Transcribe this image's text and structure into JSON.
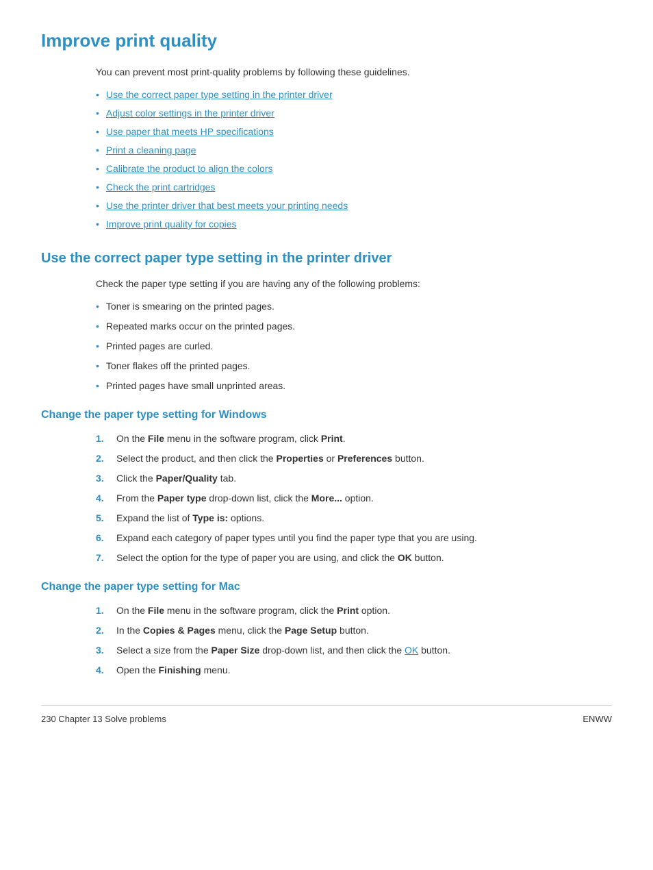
{
  "page": {
    "title": "Improve print quality",
    "intro": "You can prevent most print-quality problems by following these guidelines.",
    "toc": [
      "Use the correct paper type setting in the printer driver",
      "Adjust color settings in the printer driver",
      "Use paper that meets HP specifications",
      "Print a cleaning page",
      "Calibrate the product to align the colors",
      "Check the print cartridges",
      "Use the printer driver that best meets your printing needs",
      "Improve print quality for copies"
    ],
    "section1": {
      "title": "Use the correct paper type setting in the printer driver",
      "intro": "Check the paper type setting if you are having any of the following problems:",
      "problems": [
        "Toner is smearing on the printed pages.",
        "Repeated marks occur on the printed pages.",
        "Printed pages are curled.",
        "Toner flakes off the printed pages.",
        "Printed pages have small unprinted areas."
      ],
      "subsection_windows": {
        "title": "Change the paper type setting for Windows",
        "steps": [
          {
            "num": "1.",
            "text_parts": [
              {
                "t": "On the "
              },
              {
                "b": "File"
              },
              {
                "t": " menu in the software program, click "
              },
              {
                "b": "Print"
              },
              {
                "t": "."
              }
            ]
          },
          {
            "num": "2.",
            "text_parts": [
              {
                "t": "Select the product, and then click the "
              },
              {
                "b": "Properties"
              },
              {
                "t": " or "
              },
              {
                "b": "Preferences"
              },
              {
                "t": " button."
              }
            ]
          },
          {
            "num": "3.",
            "text_parts": [
              {
                "t": "Click the "
              },
              {
                "b": "Paper/Quality"
              },
              {
                "t": " tab."
              }
            ]
          },
          {
            "num": "4.",
            "text_parts": [
              {
                "t": "From the "
              },
              {
                "b": "Paper type"
              },
              {
                "t": " drop-down list, click the "
              },
              {
                "b": "More..."
              },
              {
                "t": " option."
              }
            ]
          },
          {
            "num": "5.",
            "text_parts": [
              {
                "t": "Expand the list of "
              },
              {
                "b": "Type is:"
              },
              {
                "t": " options."
              }
            ]
          },
          {
            "num": "6.",
            "text_parts": [
              {
                "t": "Expand each category of paper types until you find the paper type that you are using."
              }
            ]
          },
          {
            "num": "7.",
            "text_parts": [
              {
                "t": "Select the option for the type of paper you are using, and click the "
              },
              {
                "b": "OK"
              },
              {
                "t": " button."
              }
            ]
          }
        ]
      },
      "subsection_mac": {
        "title": "Change the paper type setting for Mac",
        "steps": [
          {
            "num": "1.",
            "text_parts": [
              {
                "t": "On the "
              },
              {
                "b": "File"
              },
              {
                "t": " menu in the software program, click the "
              },
              {
                "b": "Print"
              },
              {
                "t": " option."
              }
            ]
          },
          {
            "num": "2.",
            "text_parts": [
              {
                "t": "In the "
              },
              {
                "b": "Copies & Pages"
              },
              {
                "t": " menu, click the "
              },
              {
                "b": "Page Setup"
              },
              {
                "t": " button."
              }
            ]
          },
          {
            "num": "3.",
            "text_parts": [
              {
                "t": "Select a size from the "
              },
              {
                "b": "Paper Size"
              },
              {
                "t": " drop-down list, and then click the "
              },
              {
                "ok": "OK"
              },
              {
                "t": " button."
              }
            ]
          },
          {
            "num": "4.",
            "text_parts": [
              {
                "t": "Open the "
              },
              {
                "b": "Finishing"
              },
              {
                "t": " menu."
              }
            ]
          }
        ]
      }
    },
    "footer": {
      "left": "230  Chapter 13  Solve problems",
      "right": "ENWW"
    }
  }
}
